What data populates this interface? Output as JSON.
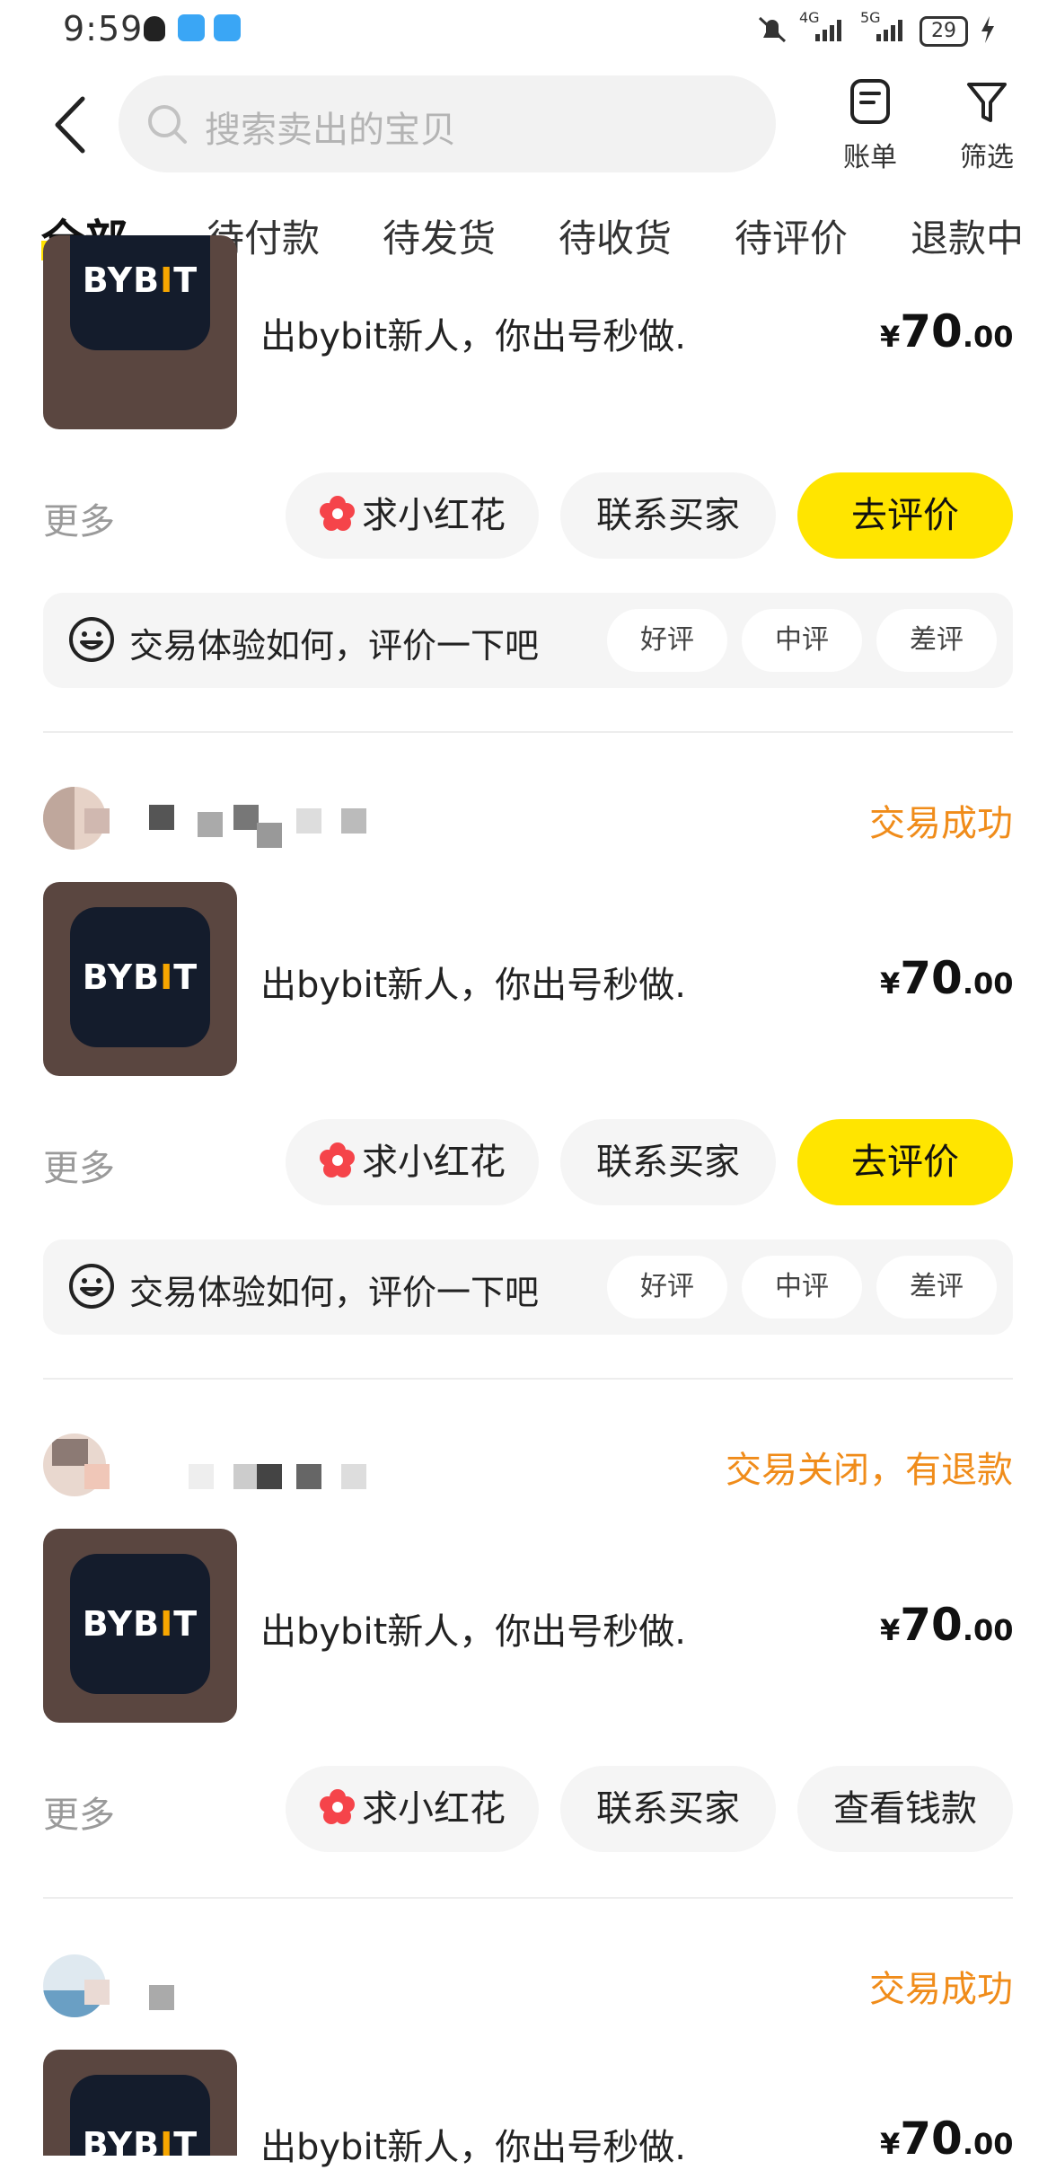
{
  "status_bar": {
    "time": "9:59",
    "battery": "29",
    "network1": "4G",
    "network2": "5G"
  },
  "search": {
    "placeholder": "搜索卖出的宝贝"
  },
  "header": {
    "bill_label": "账单",
    "filter_label": "筛选"
  },
  "tabs": [
    "全部",
    "待付款",
    "待发货",
    "待收货",
    "待评价",
    "退款中"
  ],
  "thumb_logo": {
    "left": "BYB",
    "bar": "I",
    "right": "T"
  },
  "orders": [
    {
      "status": "",
      "title": "出bybit新人，你出号秒做.",
      "price_symbol": "¥",
      "price_int": "70",
      "price_dec": ".00",
      "more": "更多",
      "flower_btn": "求小红花",
      "contact_btn": "联系买家",
      "primary_btn": "去评价",
      "eval_prompt": "交易体验如何，评价一下吧",
      "eval_good": "好评",
      "eval_mid": "中评",
      "eval_bad": "差评"
    },
    {
      "status": "交易成功",
      "title": "出bybit新人，你出号秒做.",
      "price_symbol": "¥",
      "price_int": "70",
      "price_dec": ".00",
      "more": "更多",
      "flower_btn": "求小红花",
      "contact_btn": "联系买家",
      "primary_btn": "去评价",
      "eval_prompt": "交易体验如何，评价一下吧",
      "eval_good": "好评",
      "eval_mid": "中评",
      "eval_bad": "差评"
    },
    {
      "status": "交易关闭，有退款",
      "title": "出bybit新人，你出号秒做.",
      "price_symbol": "¥",
      "price_int": "70",
      "price_dec": ".00",
      "more": "更多",
      "flower_btn": "求小红花",
      "contact_btn": "联系买家",
      "primary_btn": "查看钱款"
    },
    {
      "status": "交易成功",
      "title": "出bybit新人，你出号秒做.",
      "price_symbol": "¥",
      "price_int": "70",
      "price_dec": ".00"
    }
  ],
  "colors": {
    "accent": "#ffe500",
    "status": "#f08c1a",
    "flower": "#f5444a"
  }
}
